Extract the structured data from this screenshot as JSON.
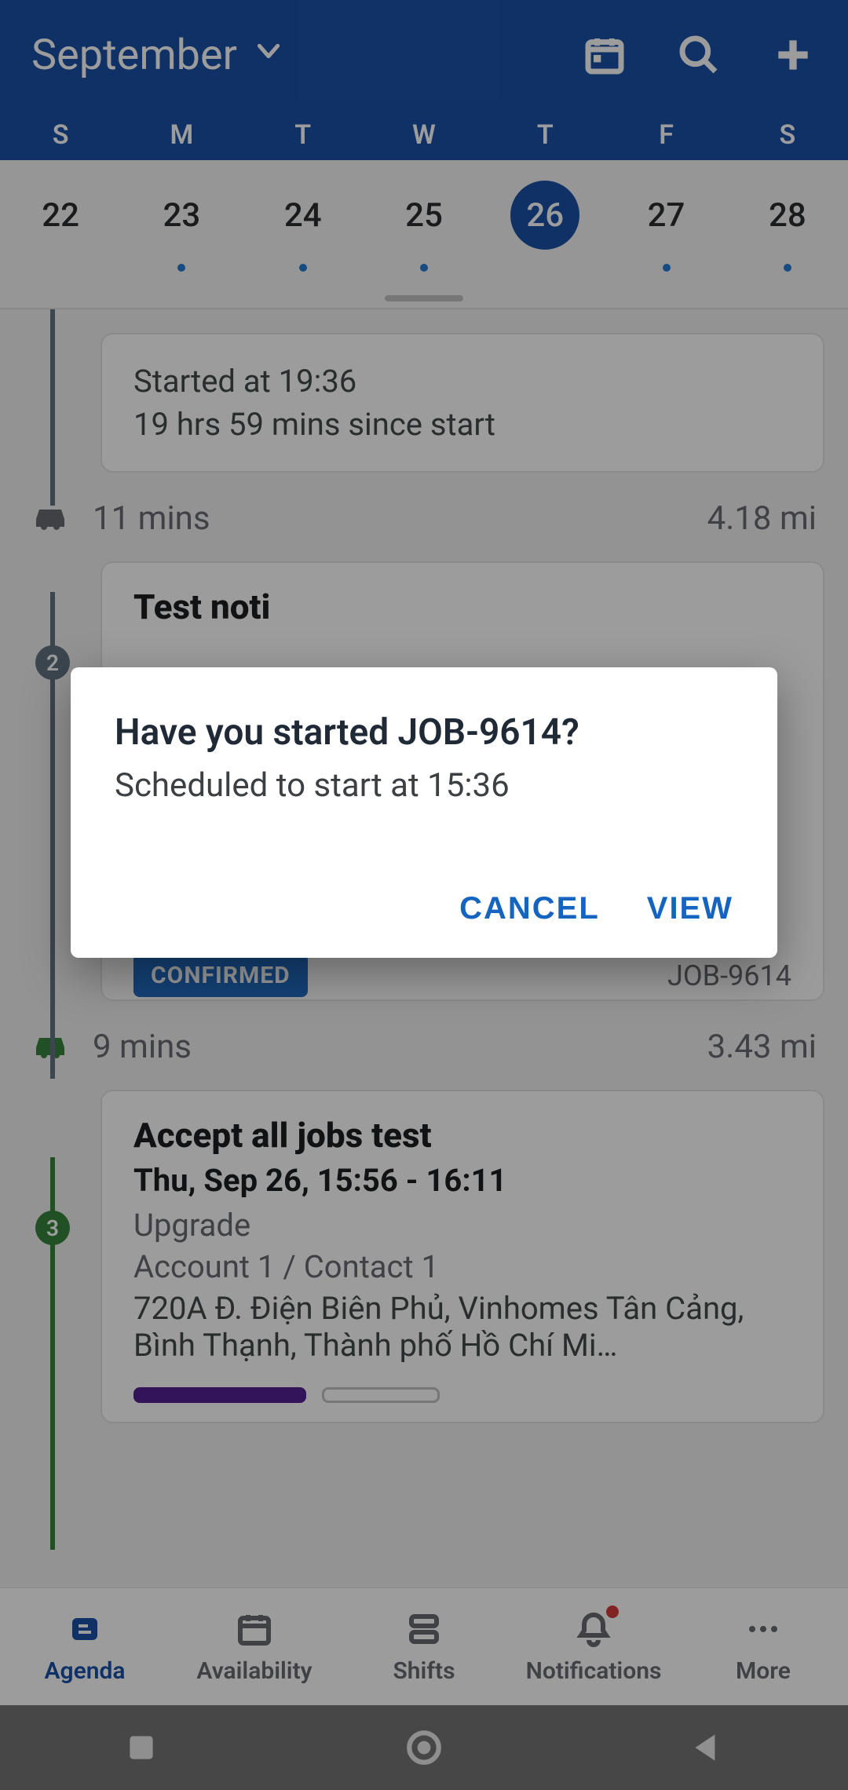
{
  "header": {
    "month": "September"
  },
  "weekdays": [
    "S",
    "M",
    "T",
    "W",
    "T",
    "F",
    "S"
  ],
  "week": [
    {
      "num": "22",
      "has_dot": false,
      "selected": false
    },
    {
      "num": "23",
      "has_dot": true,
      "selected": false
    },
    {
      "num": "24",
      "has_dot": true,
      "selected": false
    },
    {
      "num": "25",
      "has_dot": true,
      "selected": false
    },
    {
      "num": "26",
      "has_dot": false,
      "selected": true
    },
    {
      "num": "27",
      "has_dot": true,
      "selected": false
    },
    {
      "num": "28",
      "has_dot": true,
      "selected": false
    }
  ],
  "prev_card": {
    "started": "Started at 19:36",
    "elapsed": "19 hrs 59 mins since start"
  },
  "drive1": {
    "mins": "11 mins",
    "miles": "4.18 mi"
  },
  "job2": {
    "title": "Test noti",
    "status_chip": "CONFIRMED",
    "code": "JOB-9614"
  },
  "drive2": {
    "mins": "9 mins",
    "miles": "3.43 mi"
  },
  "job3": {
    "stop_num": "3",
    "title": "Accept all jobs test",
    "when": "Thu, Sep 26, 15:56 - 16:11",
    "type": "Upgrade",
    "account": "Account 1 / Contact 1",
    "address": "720A Đ. Điện Biên Phủ, Vinhomes Tân Cảng, Bình Thạnh, Thành phố Hồ Chí Mi…"
  },
  "stop2_num": "2",
  "dialog": {
    "title": "Have you started JOB-9614?",
    "message": "Scheduled to start at 15:36",
    "cancel": "CANCEL",
    "view": "VIEW"
  },
  "nav": {
    "agenda": "Agenda",
    "availability": "Availability",
    "shifts": "Shifts",
    "notifications": "Notifications",
    "more": "More"
  }
}
